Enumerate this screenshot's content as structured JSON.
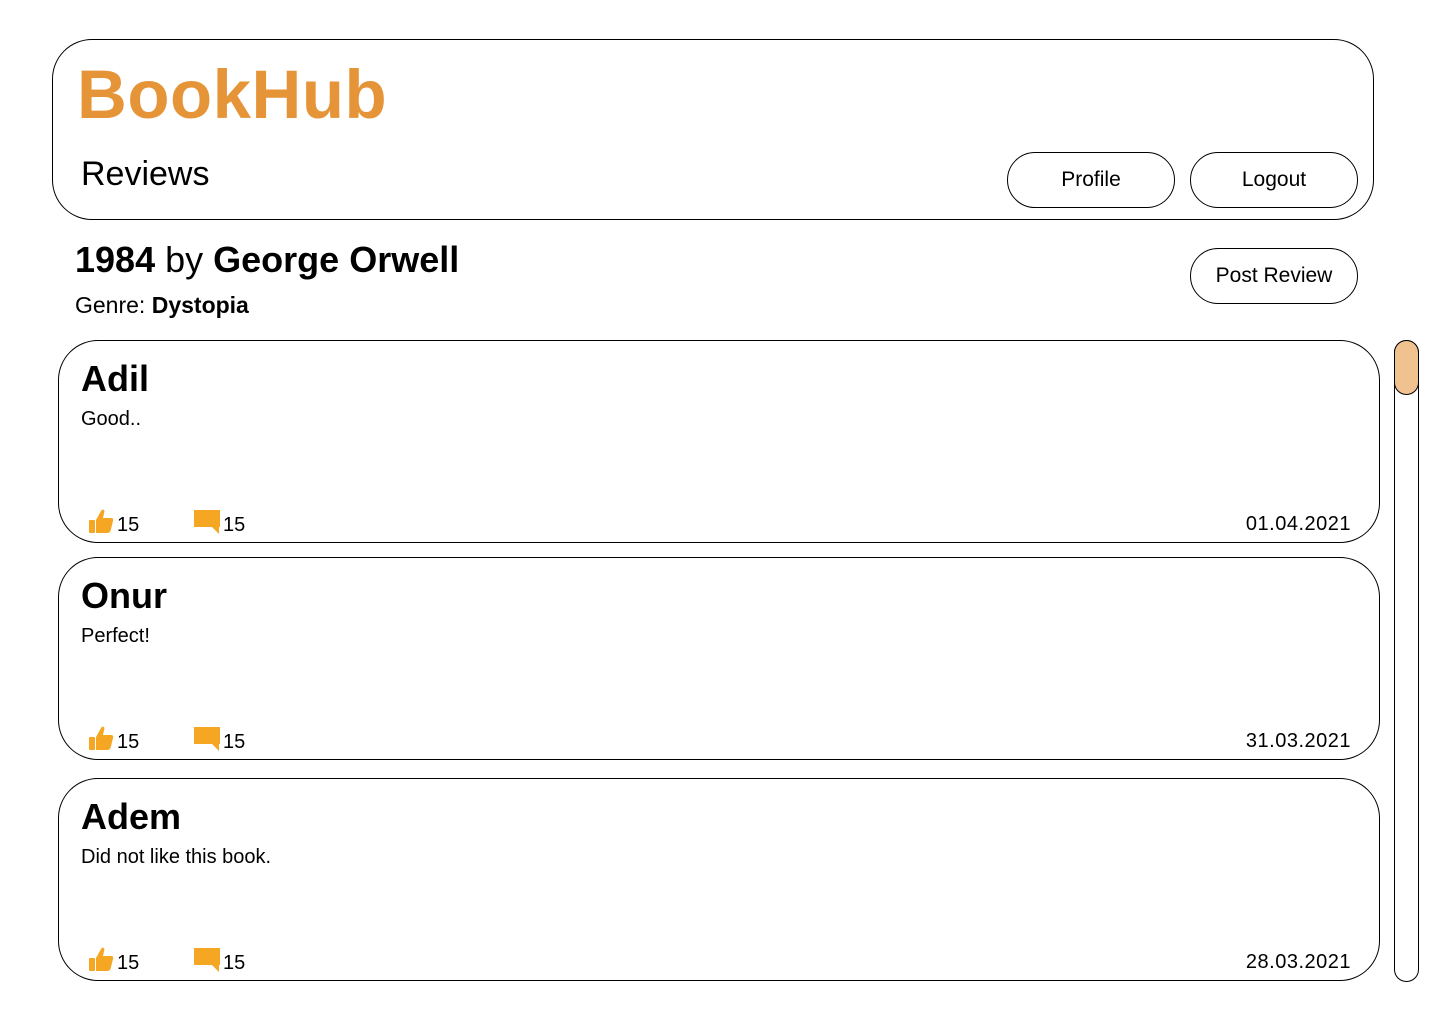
{
  "app": {
    "brand": "BookHub",
    "section_title": "Reviews",
    "brand_color": "#e69438",
    "accent_color": "#f5a623",
    "scroll_thumb_color": "#efc290"
  },
  "nav": {
    "profile_label": "Profile",
    "logout_label": "Logout"
  },
  "book": {
    "title": "1984",
    "by": "by",
    "author": "George Orwell",
    "genre_label": "Genre:",
    "genre": "Dystopia",
    "post_review_label": "Post Review"
  },
  "reviews": [
    {
      "author": "Adil",
      "text": "Good..",
      "likes": "15",
      "comments": "15",
      "date": "01.04.2021"
    },
    {
      "author": "Onur",
      "text": "Perfect!",
      "likes": "15",
      "comments": "15",
      "date": "31.03.2021"
    },
    {
      "author": "Adem",
      "text": "Did not like this book.",
      "likes": "15",
      "comments": "15",
      "date": "28.03.2021"
    }
  ],
  "icons": {
    "like": "thumbs-up-icon",
    "comment": "comment-icon"
  }
}
